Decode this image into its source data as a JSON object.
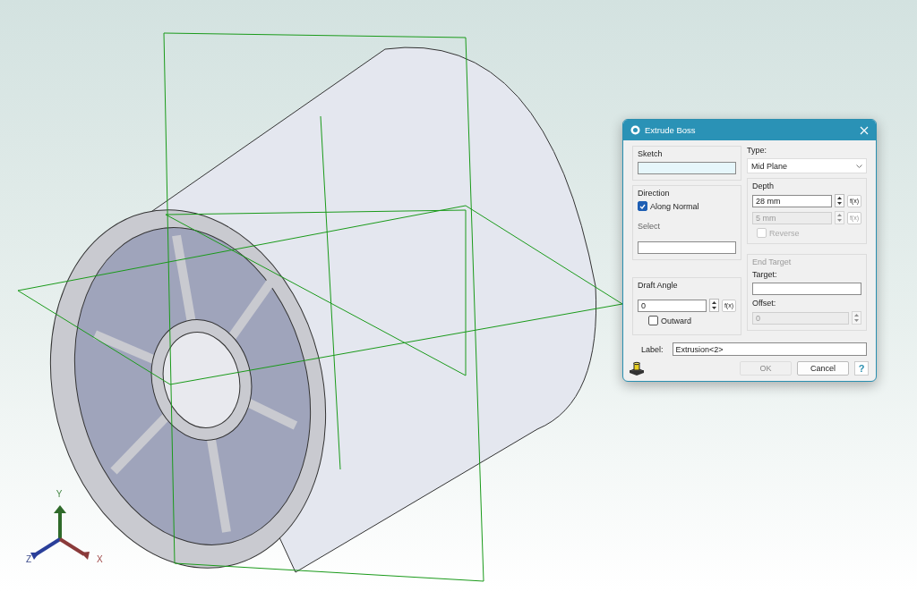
{
  "triad": {
    "y_label": "Y",
    "z_label": "Z",
    "x_label": "X"
  },
  "dialog": {
    "title": "Extrude Boss",
    "sketch": {
      "title": "Sketch"
    },
    "direction": {
      "title": "Direction",
      "along_normal": {
        "label": "Along Normal",
        "checked": true
      },
      "select_label": "Select"
    },
    "draft_angle": {
      "title": "Draft Angle",
      "value": "0",
      "function_button": "f(x)",
      "outward": {
        "label": "Outward",
        "checked": false
      }
    },
    "type": {
      "label": "Type:",
      "value": "Mid Plane"
    },
    "depth": {
      "title": "Depth",
      "value": "28 mm",
      "function_button": "f(x)",
      "second_value": "5 mm",
      "second_disabled": true,
      "second_function_button": "f(x)",
      "reverse": {
        "label": "Reverse",
        "checked": false,
        "disabled": true
      }
    },
    "end_target": {
      "title": "End Target",
      "disabled": true,
      "target_label": "Target:",
      "offset_label": "Offset:",
      "offset_value": "0"
    },
    "label": {
      "label": "Label:",
      "value": "Extrusion<2>"
    },
    "buttons": [
      {
        "label": "OK",
        "disabled": true
      },
      {
        "label": "Cancel",
        "disabled": false
      }
    ],
    "help": "?"
  }
}
